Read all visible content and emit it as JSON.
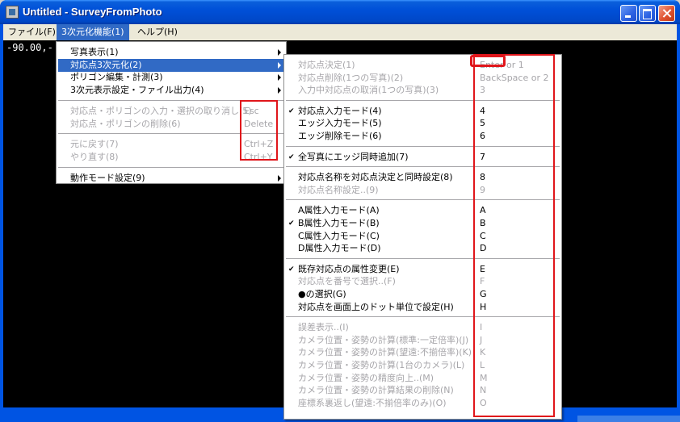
{
  "window": {
    "title": "Untitled - SurveyFromPhoto",
    "icon": "app-icon",
    "controls": [
      "minimize",
      "maximize",
      "close"
    ]
  },
  "menubar": {
    "items": [
      {
        "label": "ファイル(F)"
      },
      {
        "label": "3次元化機能(1)"
      },
      {
        "label": "ヘルプ(H)"
      }
    ]
  },
  "canvas": {
    "coordinate_text": "-90.00,-"
  },
  "menu_main": {
    "groups": [
      [
        {
          "label": "写真表示(1)",
          "submenu": true
        },
        {
          "label": "対応点3次元化(2)",
          "submenu": true,
          "highlighted": true
        },
        {
          "label": "ポリゴン編集・計測(3)",
          "submenu": true
        },
        {
          "label": "3次元表示設定・ファイル出力(4)",
          "submenu": true
        }
      ],
      [
        {
          "label": "対応点・ポリゴンの入力・選択の取り消し(5)",
          "shortcut": "Esc",
          "disabled": true
        },
        {
          "label": "対応点・ポリゴンの削除(6)",
          "shortcut": "Delete",
          "disabled": true
        }
      ],
      [
        {
          "label": "元に戻す(7)",
          "shortcut": "Ctrl+Z",
          "disabled": true
        },
        {
          "label": "やり直す(8)",
          "shortcut": "Ctrl+Y",
          "disabled": true
        }
      ],
      [
        {
          "label": "動作モード設定(9)",
          "submenu": true
        }
      ]
    ]
  },
  "menu_sub": {
    "groups": [
      [
        {
          "label": "対応点決定(1)",
          "shortcut": "Enter or 1",
          "disabled": true
        },
        {
          "label": "対応点削除(1つの写真)(2)",
          "shortcut": "BackSpace or 2",
          "disabled": true
        },
        {
          "label": "入力中対応点の取消(1つの写真)(3)",
          "shortcut": "3",
          "disabled": true
        }
      ],
      [
        {
          "label": "対応点入力モード(4)",
          "shortcut": "4",
          "checked": true
        },
        {
          "label": "エッジ入力モード(5)",
          "shortcut": "5"
        },
        {
          "label": "エッジ削除モード(6)",
          "shortcut": "6"
        }
      ],
      [
        {
          "label": "全写真にエッジ同時追加(7)",
          "shortcut": "7",
          "checked": true
        }
      ],
      [
        {
          "label": "対応点名称を対応点決定と同時設定(8)",
          "shortcut": "8"
        },
        {
          "label": "対応点名称設定..(9)",
          "shortcut": "9",
          "disabled": true
        }
      ],
      [
        {
          "label": "A属性入力モード(A)",
          "shortcut": "A"
        },
        {
          "label": "B属性入力モード(B)",
          "shortcut": "B",
          "checked": true
        },
        {
          "label": "C属性入力モード(C)",
          "shortcut": "C"
        },
        {
          "label": "D属性入力モード(D)",
          "shortcut": "D"
        }
      ],
      [
        {
          "label": "既存対応点の属性変更(E)",
          "shortcut": "E",
          "checked": true
        },
        {
          "label": "対応点を番号で選択..(F)",
          "shortcut": "F",
          "disabled": true
        },
        {
          "label": "●の選択(G)",
          "shortcut": "G"
        },
        {
          "label": "対応点を画面上のドット単位で設定(H)",
          "shortcut": "H"
        }
      ],
      [
        {
          "label": "誤差表示..(I)",
          "shortcut": "I",
          "disabled": true
        },
        {
          "label": "カメラ位置・姿勢の計算(標準:一定倍率)(J)",
          "shortcut": "J",
          "disabled": true
        },
        {
          "label": "カメラ位置・姿勢の計算(望遠:不揃倍率)(K)",
          "shortcut": "K",
          "disabled": true
        },
        {
          "label": "カメラ位置・姿勢の計算(1台のカメラ)(L)",
          "shortcut": "L",
          "disabled": true
        },
        {
          "label": "カメラ位置・姿勢の精度向上..(M)",
          "shortcut": "M",
          "disabled": true
        },
        {
          "label": "カメラ位置・姿勢の計算結果の削除(N)",
          "shortcut": "N",
          "disabled": true
        },
        {
          "label": "座標系裏返し(望遠:不揃倍率のみ)(O)",
          "shortcut": "O",
          "disabled": true
        }
      ]
    ]
  },
  "colors": {
    "highlight": "#316ac5",
    "disabled_text": "#a7a6aa",
    "annotation_red": "#e0161b",
    "client_background": "#000000"
  }
}
